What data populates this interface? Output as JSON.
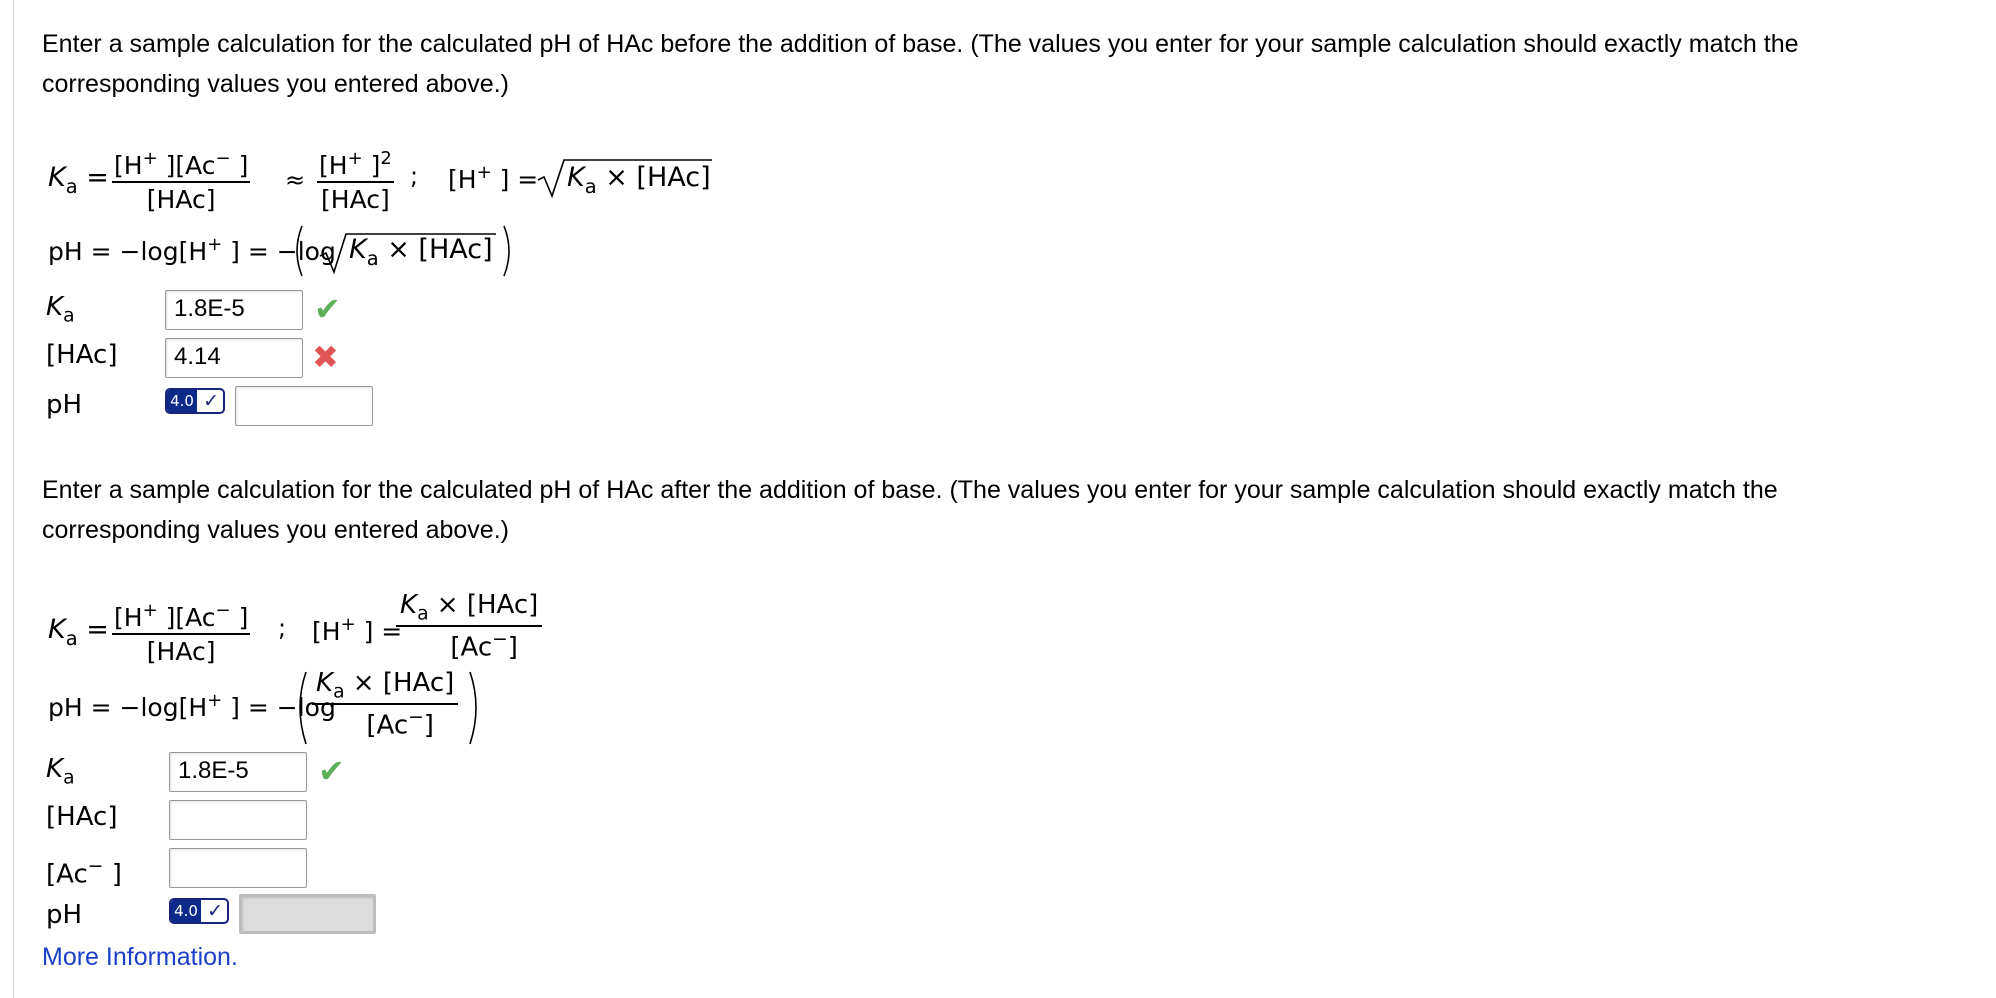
{
  "section1": {
    "instructions": "Enter a sample calculation for the calculated pH of HAc before the addition of base. (The values you enter for your sample calculation should exactly match the corresponding values you entered above.)",
    "rows": [
      {
        "label_main": "K",
        "label_sub": "a",
        "value": "1.8E-5",
        "status": "correct"
      },
      {
        "label_main": "[HAc]",
        "label_sub": "",
        "value": "4.14",
        "status": "incorrect"
      },
      {
        "label_main": "pH",
        "label_sub": "",
        "value": "",
        "status": ""
      }
    ],
    "badge_label": "4.0"
  },
  "section2": {
    "instructions": "Enter a sample calculation for the calculated pH of HAc after the addition of base. (The values you enter for your sample calculation should exactly match the corresponding values you entered above.)",
    "rows": [
      {
        "label_main": "K",
        "label_sub": "a",
        "value": "1.8E-5",
        "status": "correct"
      },
      {
        "label_main": "[HAc]",
        "label_sub": "",
        "value": "",
        "status": ""
      },
      {
        "label_main": "[Ac",
        "label_sub": "",
        "value": "",
        "status": ""
      },
      {
        "label_main": "pH",
        "label_sub": "",
        "value": "",
        "status": "disabled"
      }
    ],
    "badge_label": "4.0"
  },
  "link": {
    "more_info": "More Information."
  },
  "colors": {
    "correct": "#5fae5a",
    "incorrect": "#e05555",
    "link": "#1a3fc9",
    "badge": "#0b2a8a"
  }
}
